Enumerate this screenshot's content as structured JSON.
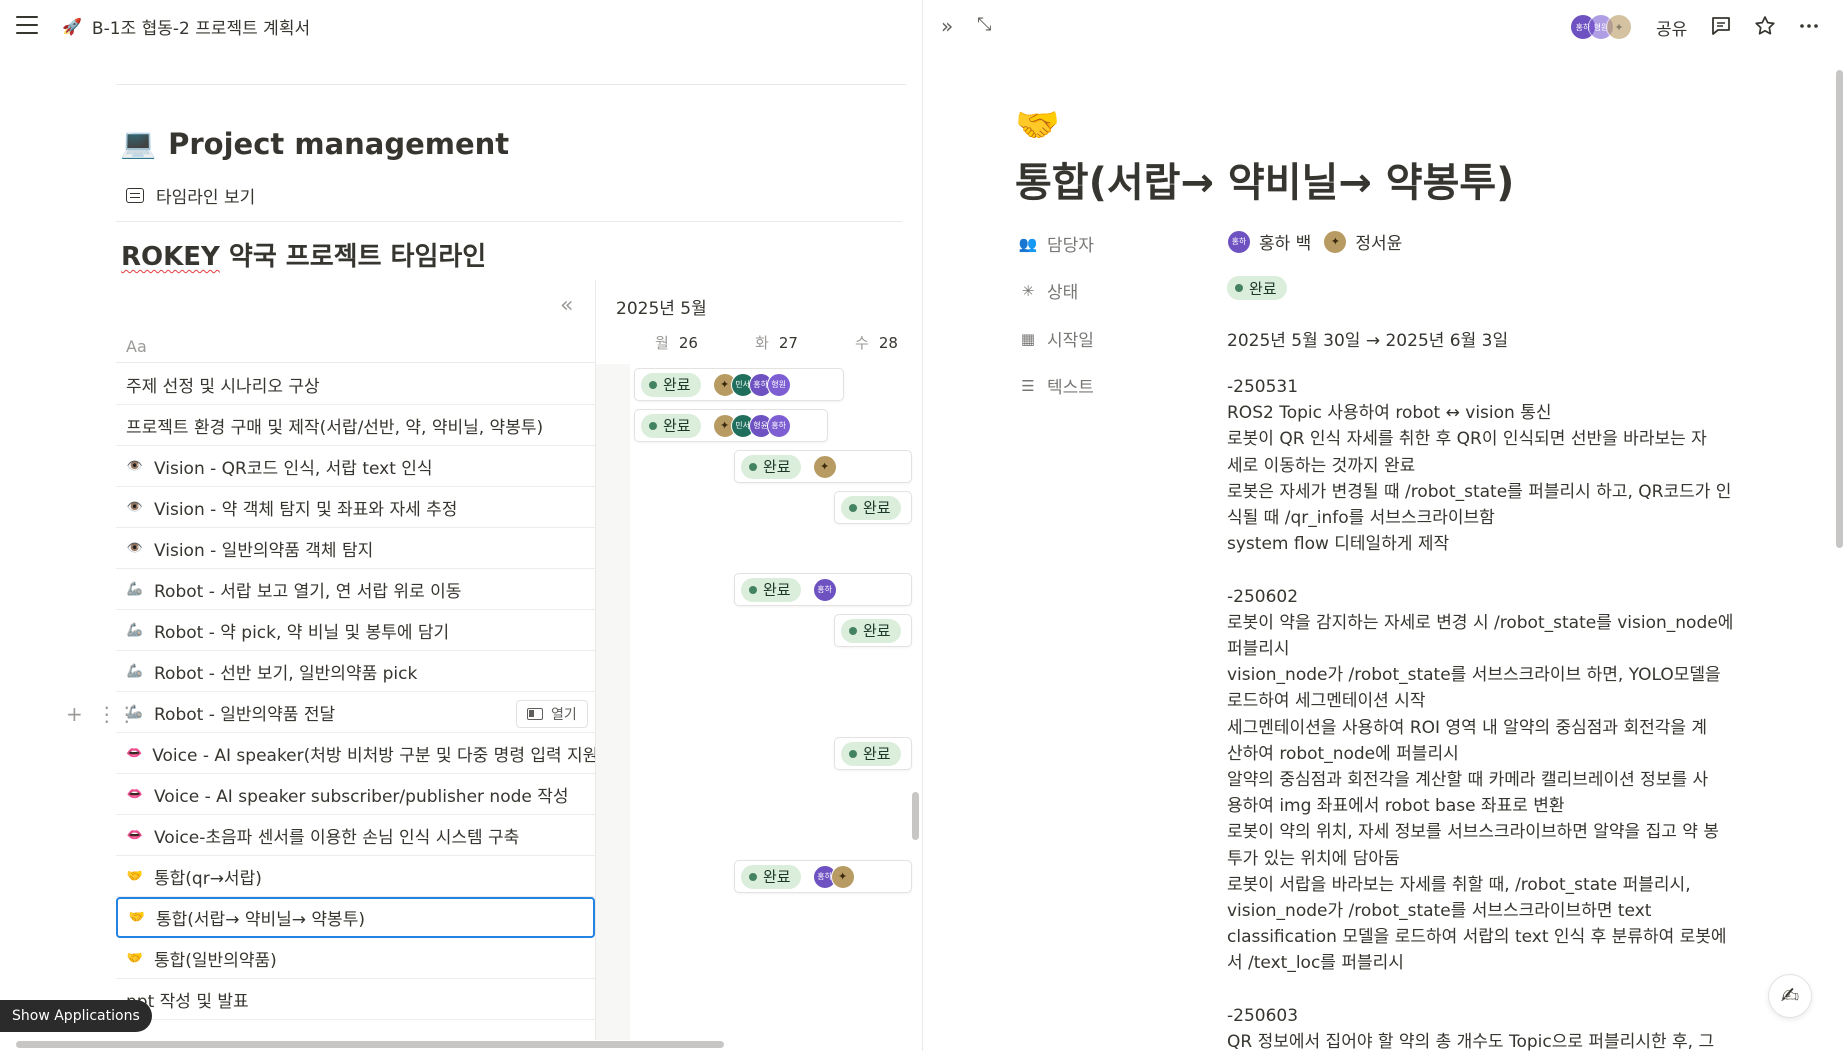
{
  "breadcrumb": {
    "emoji": "🚀",
    "title": "B-1조 협동-2 프로젝트 계획서"
  },
  "project": {
    "emoji": "💻",
    "title": "Project management",
    "view_tab": "타임라인 보기",
    "timeline_title_prefix": "ROKEY",
    "timeline_title_rest": " 약국 프로젝트 타임라인"
  },
  "timeline": {
    "name_header": "Aa",
    "month": "2025년 5월",
    "days": [
      {
        "weekday": "월",
        "num": "26"
      },
      {
        "weekday": "화",
        "num": "27"
      },
      {
        "weekday": "수",
        "num": "28"
      }
    ],
    "open_label": "열기",
    "rows": [
      {
        "icon": "",
        "name": "주제 선정 및 시나리오 구상"
      },
      {
        "icon": "",
        "name": "프로젝트 환경 구매 및 제작(서랍/선반, 약, 약비닐, 약봉투)"
      },
      {
        "icon": "👁️",
        "name": "Vision - QR코드 인식, 서랍 text 인식"
      },
      {
        "icon": "👁️",
        "name": "Vision - 약 객체 탐지 및 좌표와 자세 추정"
      },
      {
        "icon": "👁️",
        "name": "Vision - 일반의약품 객체 탐지"
      },
      {
        "icon": "🦾",
        "name": "Robot - 서랍 보고 열기, 연 서랍 위로 이동"
      },
      {
        "icon": "🦾",
        "name": "Robot - 약 pick, 약 비닐 및 봉투에 담기"
      },
      {
        "icon": "🦾",
        "name": "Robot - 선반 보기, 일반의약품 pick"
      },
      {
        "icon": "🦾",
        "name": "Robot - 일반의약품 전달"
      },
      {
        "icon": "👄",
        "name": "Voice - AI speaker(처방 비처방 구분 및 다중 명령 입력 지원)"
      },
      {
        "icon": "👄",
        "name": "Voice - AI speaker subscriber/publisher node 작성"
      },
      {
        "icon": "👄",
        "name": "Voice-초음파 센서를 이용한 손님 인식 시스템 구축"
      },
      {
        "icon": "🤝",
        "name": "통합(qr→서랍)"
      },
      {
        "icon": "🤝",
        "name": "통합(서랍→ 약비닐→ 약봉투)"
      },
      {
        "icon": "🤝",
        "name": "통합(일반의약품)"
      },
      {
        "icon": "",
        "name": "ppt 작성 및 발표"
      }
    ],
    "status_label": "완료",
    "avatar_labels": {
      "minseo": "민서",
      "hongha": "홍하",
      "hyungwon": "형원",
      "hyungyun": "형윤"
    }
  },
  "taskbar": {
    "show_applications": "Show Applications"
  },
  "detail": {
    "share_label": "공유",
    "emoji": "🤝",
    "title": "통합(서랍→ 약비닐→ 약봉투)",
    "props": {
      "assignee_label": "담당자",
      "assignee_1_avatar": "홍하",
      "assignee_1": "홍하 백",
      "assignee_2": "정서윤",
      "status_label": "상태",
      "status_value": "완료",
      "start_label": "시작일",
      "start_value": "2025년 5월 30일 → 2025년 6월 3일",
      "text_label": "텍스트"
    },
    "body_lines": [
      "-250531",
      "ROS2 Topic 사용하여 robot ↔ vision 통신",
      "로봇이 QR 인식 자세를 취한 후 QR이 인식되면 선반을 바라보는 자",
      "세로 이동하는 것까지 완료",
      "로봇은 자세가 변경될 때 /robot_state를 퍼블리시 하고, QR코드가 인",
      "식될 때 /qr_info를 서브스크라이브함",
      "system flow 디테일하게 제작",
      "",
      "-250602",
      "로봇이 약을 감지하는 자세로 변경 시 /robot_state를 vision_node에",
      "퍼블리시",
      "vision_node가 /robot_state를 서브스크라이브 하면, YOLO모델을",
      "로드하여 세그멘테이션 시작",
      "세그멘테이션을 사용하여 ROI 영역 내 알약의 중심점과 회전각을 계",
      "산하여 robot_node에 퍼블리시",
      "알약의 중심점과 회전각을 계산할 때 카메라 캘리브레이션 정보를 사",
      "용하여 img 좌표에서 robot base 좌표로 변환",
      "로봇이 약의 위치, 자세 정보를 서브스크라이브하면 알약을 집고 약 봉",
      "투가 있는 위치에 담아둠",
      "로봇이 서랍을 바라보는 자세를 취할 때, /robot_state 퍼블리시,",
      "vision_node가 /robot_state를 서브스크라이브하면 text",
      "classification 모델을 로드하여 서랍의 text 인식 후 분류하여 로봇에",
      "서 /text_loc를 퍼블리시",
      "",
      "-250603",
      "QR 정보에서 집어야 할 약의 총 개수도 Topic으로 퍼블리시한 후, 그"
    ]
  },
  "colors": {
    "accent": "#2383e2",
    "status_bg": "#dbeddb",
    "status_dot": "#448361",
    "avatar_purple": "#6f52c2",
    "avatar_teal": "#1f6f5c"
  }
}
